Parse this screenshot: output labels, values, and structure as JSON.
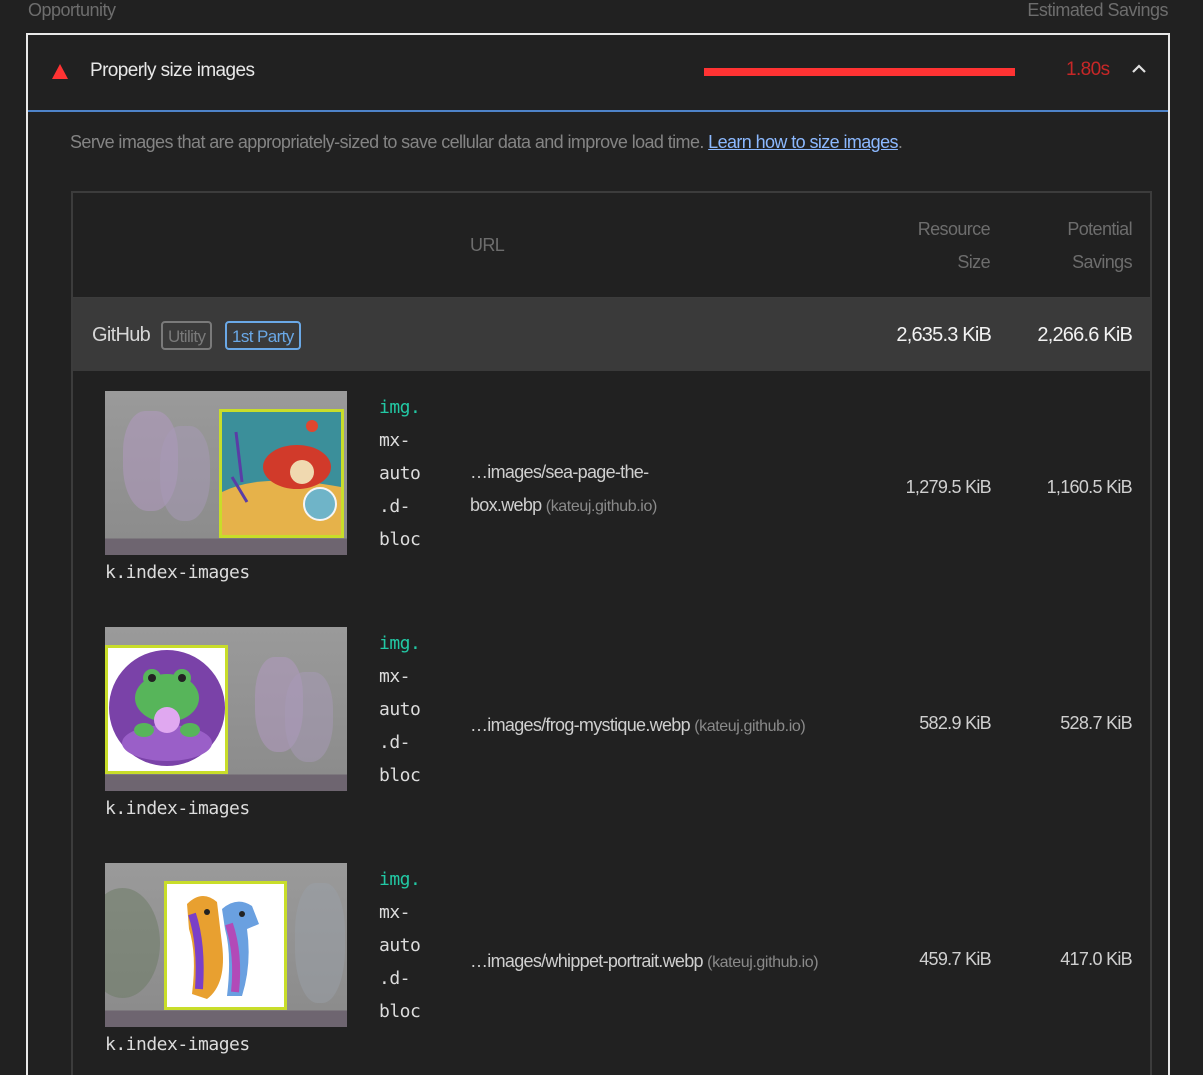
{
  "columns": {
    "left": "Opportunity",
    "right": "Estimated Savings"
  },
  "audit": {
    "title": "Properly size images",
    "savings": "1.80s",
    "status": "fail",
    "colors": {
      "fail": "#ff3333",
      "accent": "#4e83c9",
      "link": "#8cb9ff"
    },
    "description": "Serve images that are appropriately-sized to save cellular data and improve load time.",
    "link_text": "Learn how to size images",
    "link_suffix": "."
  },
  "table": {
    "headers": {
      "url": "URL",
      "size_line1": "Resource",
      "size_line2": "Size",
      "savings_line1": "Potential",
      "savings_line2": "Savings"
    },
    "group": {
      "name": "GitHub",
      "badges": [
        "Utility",
        "1st Party"
      ],
      "size": "2,635.3 KiB",
      "savings": "2,266.6 KiB"
    },
    "rows": [
      {
        "selector_a": "img.",
        "selector_b": "mx-\nauto\n.d-\nbloc",
        "selector_c": "k.index-images",
        "url_line1": "…images/sea-page-the-",
        "url_line2": "box.webp",
        "host": "(kateuj.github.io)",
        "size": "1,279.5 KiB",
        "savings": "1,160.5 KiB"
      },
      {
        "selector_a": "img.",
        "selector_b": "mx-\nauto\n.d-\nbloc",
        "selector_c": "k.index-images",
        "url_line1": "…images/frog-mystique.webp",
        "host": "(kateuj.github.io)",
        "size": "582.9 KiB",
        "savings": "528.7 KiB"
      },
      {
        "selector_a": "img.",
        "selector_b": "mx-\nauto\n.d-\nbloc",
        "selector_c": "k.index-images",
        "url_line1": "…images/whippet-portrait.webp",
        "host": "(kateuj.github.io)",
        "size": "459.7 KiB",
        "savings": "417.0 KiB"
      }
    ]
  }
}
